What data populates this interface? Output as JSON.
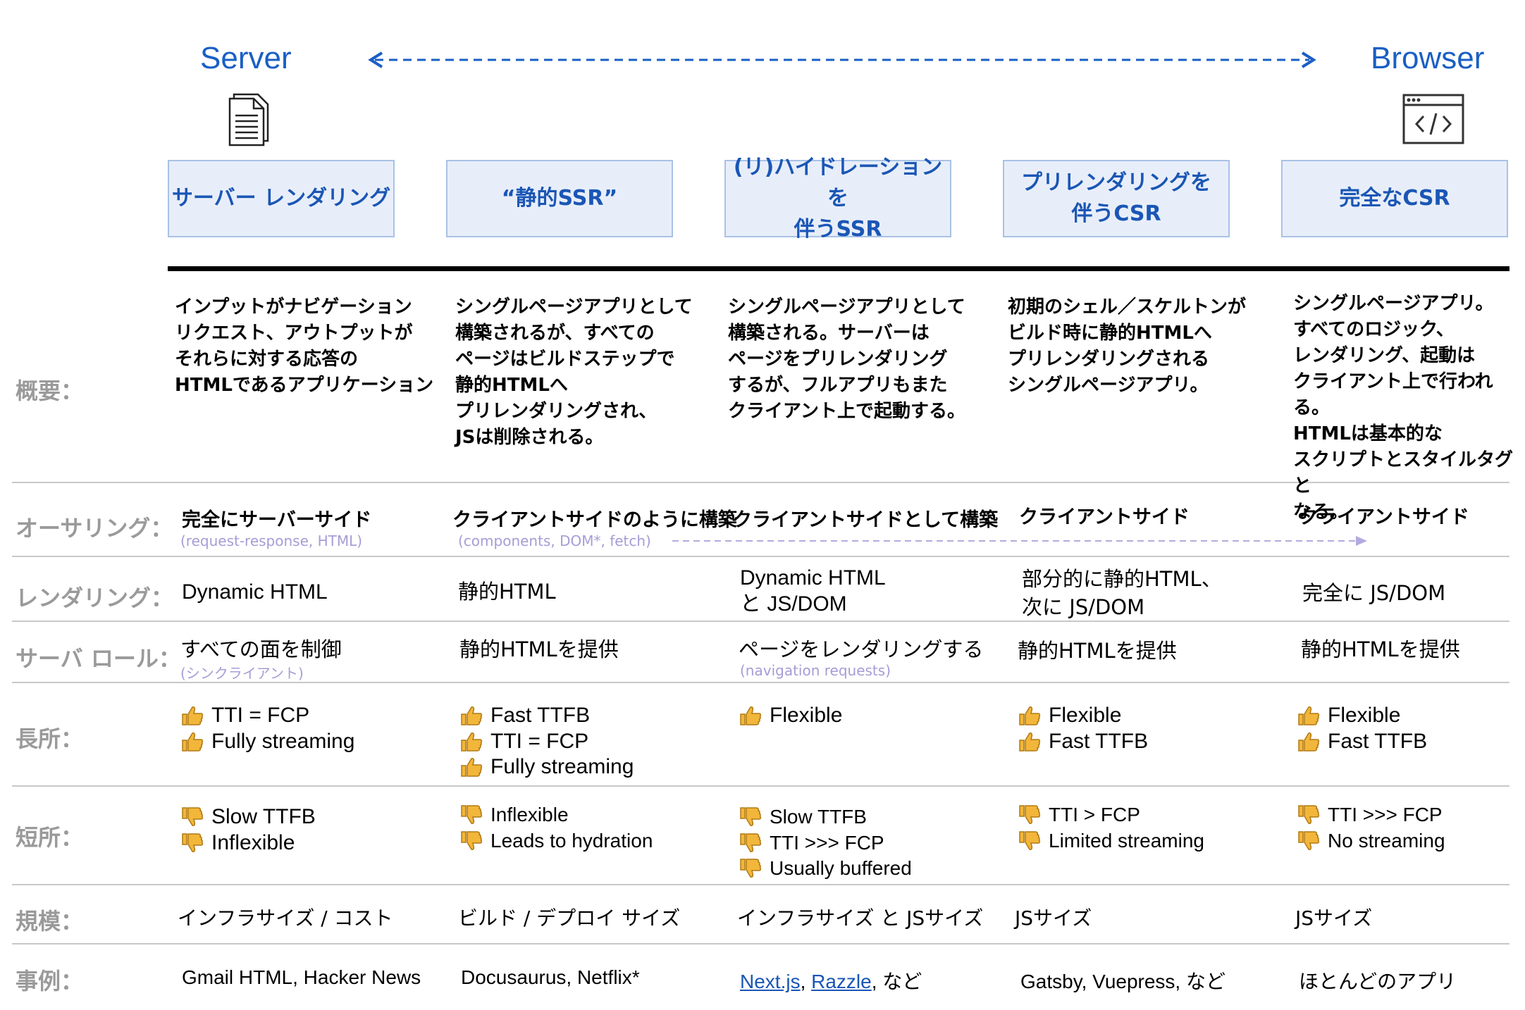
{
  "axis": {
    "left": "Server",
    "right": "Browser"
  },
  "columns": [
    {
      "title": "サーバー レンダリング"
    },
    {
      "title": "“静的SSR”"
    },
    {
      "title": "(リ)ハイドレーションを\n伴うSSR"
    },
    {
      "title": "プリレンダリングを\n伴うCSR"
    },
    {
      "title": "完全なCSR"
    }
  ],
  "row_labels": {
    "overview": "概要：",
    "authoring": "オーサリング：",
    "rendering": "レンダリング：",
    "server_role": "サーバ ロール：",
    "pros": "長所：",
    "cons": "短所：",
    "scale": "規模：",
    "examples": "事例："
  },
  "overview": [
    "インプットがナビゲーション\nリクエスト、アウトプットが\nそれらに対する応答の\nHTMLであるアプリケーション",
    "シングルページアプリとして\n構築されるが、すべての\nページはビルドステップで\n静的HTMLへ\nプリレンダリングされ、\nJSは削除される。",
    "シングルページアプリとして\n構築される。サーバーは\nページをプリレンダリング\nするが、フルアプリもまた\nクライアント上で起動する。",
    "初期のシェル／スケルトンが\nビルド時に静的HTMLへ\nプリレンダリングされる\nシングルページアプリ。",
    "シングルページアプリ。\nすべてのロジック、\nレンダリング、起動は\nクライアント上で行われる。\nHTMLは基本的な\nスクリプトとスタイルタグと\nなる。"
  ],
  "authoring": [
    {
      "main": "完全にサーバーサイド",
      "note": "(request-response, HTML)"
    },
    {
      "main": "クライアントサイドのように構築",
      "note": "(components, DOM*, fetch)"
    },
    {
      "main": "クライアントサイドとして構築",
      "note": ""
    },
    {
      "main": "クライアントサイド",
      "note": ""
    },
    {
      "main": "クライアントサイド",
      "note": ""
    }
  ],
  "rendering": [
    "Dynamic HTML",
    "静的HTML",
    "Dynamic HTML\n  と    JS/DOM",
    "部分的に静的HTML、\n次に JS/DOM",
    "完全に JS/DOM"
  ],
  "server_role": [
    {
      "main": "すべての面を制御",
      "note": "(シンクライアント)"
    },
    {
      "main": "静的HTMLを提供",
      "note": ""
    },
    {
      "main": "ページをレンダリングする",
      "note": "(navigation requests)"
    },
    {
      "main": "静的HTMLを提供",
      "note": ""
    },
    {
      "main": "静的HTMLを提供",
      "note": ""
    }
  ],
  "pros": [
    [
      "TTI = FCP",
      "Fully streaming"
    ],
    [
      "Fast TTFB",
      "TTI = FCP",
      "Fully streaming"
    ],
    [
      "Flexible"
    ],
    [
      "Flexible",
      "Fast TTFB"
    ],
    [
      "Flexible",
      "Fast TTFB"
    ]
  ],
  "cons": [
    [
      "Slow TTFB",
      "Inflexible"
    ],
    [
      "Inflexible",
      "Leads to hydration"
    ],
    [
      "Slow TTFB",
      "TTI >>> FCP",
      "Usually buffered"
    ],
    [
      "TTI > FCP",
      "Limited streaming"
    ],
    [
      "TTI >>> FCP",
      "No streaming"
    ]
  ],
  "scale": [
    "インフラサイズ / コスト",
    "ビルド / デプロイ サイズ",
    "インフラサイズ と JSサイズ",
    "JSサイズ",
    "JSサイズ"
  ],
  "examples": {
    "col1": "Gmail HTML, Hacker News",
    "col2": "Docusaurus, Netflix*",
    "col3_link1": "Next.js",
    "col3_sep": ", ",
    "col3_link2": "Razzle",
    "col3_tail": ", など",
    "col4": "Gatsby, Vuepress, など",
    "col5": "ほとんどのアプリ"
  },
  "colors": {
    "accent": "#1a5fc4",
    "header_fill": "#e8eef9",
    "header_border": "#a9c2e6",
    "label_gray": "#9a9a9a",
    "note_purple": "#a79cd6",
    "thumb": "#f2b63b"
  },
  "icons": {
    "left": "document-icon",
    "right": "browser-code-icon",
    "pro": "thumbs-up-icon",
    "con": "thumbs-down-icon"
  }
}
